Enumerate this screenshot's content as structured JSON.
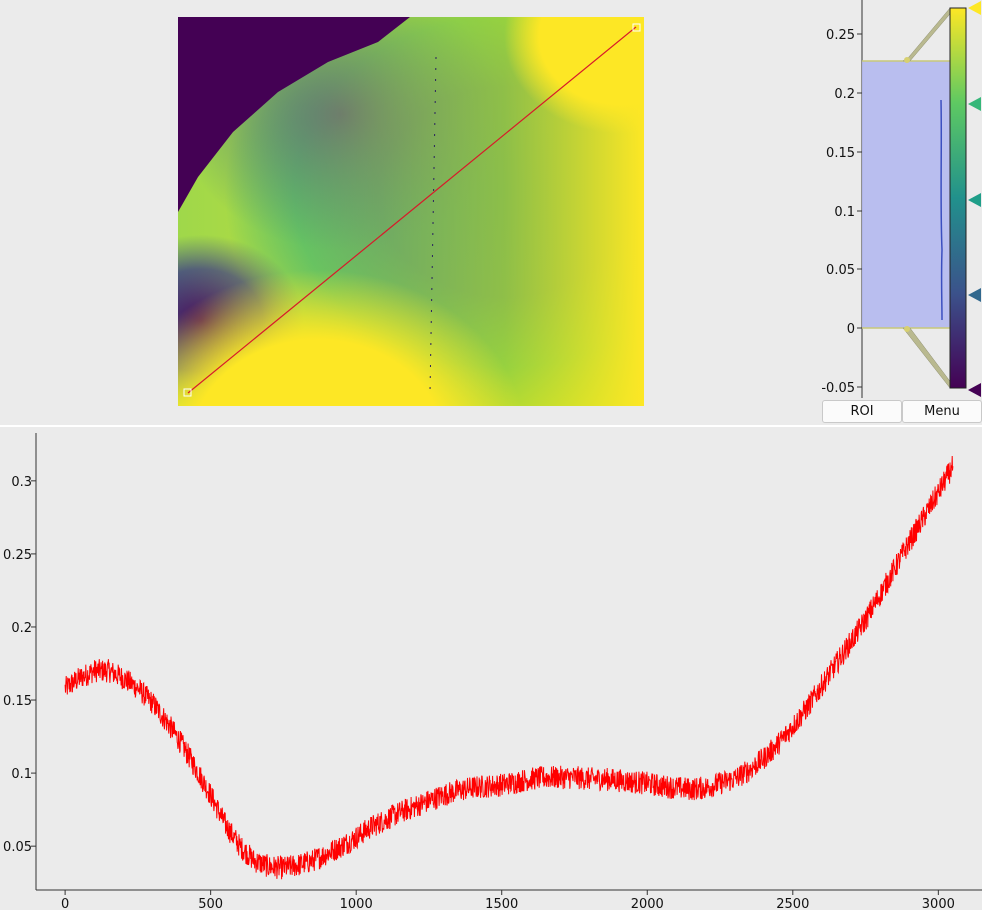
{
  "image_view": {
    "colormap": "viridis",
    "roi_line": {
      "color": "#d8192a",
      "handle_color": "#ffffff"
    }
  },
  "histogram": {
    "ticks": [
      "0.25",
      "0.2",
      "0.15",
      "0.1",
      "0.05",
      "0",
      "-0.05"
    ],
    "region_color": "#b4b9f0",
    "gradient_stops": [
      {
        "offset": "0%",
        "color": "#fde725"
      },
      {
        "offset": "25%",
        "color": "#5ec962"
      },
      {
        "offset": "50%",
        "color": "#21918c"
      },
      {
        "offset": "75%",
        "color": "#3b528b"
      },
      {
        "offset": "100%",
        "color": "#440154"
      }
    ],
    "markers": [
      "#fde725",
      "#35b779",
      "#1f9e89",
      "#31688e",
      "#440154"
    ]
  },
  "buttons": {
    "roi_label": "ROI",
    "menu_label": "Menu"
  },
  "chart_data": {
    "type": "line",
    "title": "",
    "xlabel": "",
    "ylabel": "",
    "xlim": [
      -100,
      3150
    ],
    "ylim": [
      0.02,
      0.33
    ],
    "xticks": [
      "0",
      "500",
      "1000",
      "1500",
      "2000",
      "2500",
      "3000"
    ],
    "yticks": [
      "0.3",
      "0.25",
      "0.2",
      "0.15",
      "0.1",
      "0.05"
    ],
    "grid": false,
    "series": [
      {
        "color": "#ff0000",
        "x": [
          0,
          50,
          100,
          150,
          200,
          250,
          300,
          350,
          400,
          450,
          500,
          550,
          600,
          650,
          700,
          750,
          800,
          850,
          900,
          950,
          1000,
          1050,
          1100,
          1150,
          1200,
          1250,
          1300,
          1350,
          1400,
          1450,
          1500,
          1550,
          1600,
          1650,
          1700,
          1750,
          1800,
          1850,
          1900,
          1950,
          2000,
          2050,
          2100,
          2150,
          2200,
          2250,
          2300,
          2350,
          2400,
          2450,
          2500,
          2550,
          2600,
          2650,
          2700,
          2750,
          2800,
          2850,
          2900,
          2950,
          3000,
          3050
        ],
        "y": [
          0.158,
          0.165,
          0.17,
          0.17,
          0.165,
          0.158,
          0.148,
          0.135,
          0.12,
          0.103,
          0.085,
          0.065,
          0.05,
          0.04,
          0.036,
          0.035,
          0.037,
          0.04,
          0.045,
          0.05,
          0.056,
          0.063,
          0.068,
          0.073,
          0.077,
          0.081,
          0.085,
          0.088,
          0.09,
          0.091,
          0.092,
          0.094,
          0.096,
          0.097,
          0.097,
          0.097,
          0.096,
          0.096,
          0.095,
          0.094,
          0.093,
          0.091,
          0.09,
          0.089,
          0.09,
          0.093,
          0.096,
          0.102,
          0.11,
          0.12,
          0.132,
          0.145,
          0.16,
          0.175,
          0.19,
          0.205,
          0.222,
          0.24,
          0.258,
          0.275,
          0.292,
          0.31
        ]
      }
    ]
  }
}
